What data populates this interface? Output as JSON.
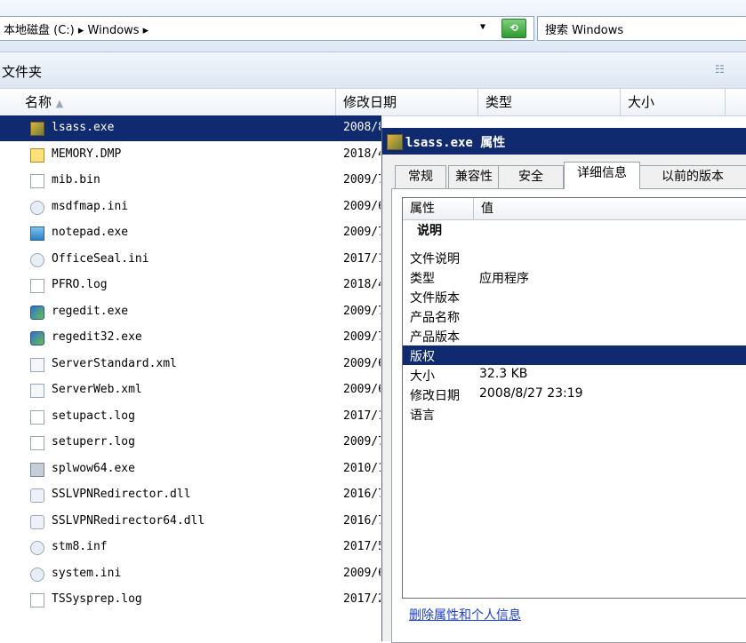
{
  "address": {
    "path": "本地磁盘 (C:) ▸ Windows ▸",
    "dropdown_arrow": "▼"
  },
  "search": {
    "placeholder": "搜索 Windows"
  },
  "folder": {
    "title": "文件夹"
  },
  "columns": {
    "name": "名称",
    "modified": "修改日期",
    "type": "类型",
    "size": "大小"
  },
  "files": [
    {
      "name": "lsass.exe",
      "date": "2008/8",
      "icon": "lsass-icon",
      "selected": true
    },
    {
      "name": "MEMORY.DMP",
      "date": "2018/4",
      "icon": "dump-file-icon"
    },
    {
      "name": "mib.bin",
      "date": "2009/7",
      "icon": "file-icon"
    },
    {
      "name": "msdfmap.ini",
      "date": "2009/6",
      "icon": "config-file-icon"
    },
    {
      "name": "notepad.exe",
      "date": "2009/7",
      "icon": "notepad-icon"
    },
    {
      "name": "OfficeSeal.ini",
      "date": "2017/1",
      "icon": "config-file-icon"
    },
    {
      "name": "PFRO.log",
      "date": "2018/4",
      "icon": "file-icon"
    },
    {
      "name": "regedit.exe",
      "date": "2009/7",
      "icon": "regedit-icon"
    },
    {
      "name": "regedit32.exe",
      "date": "2009/7",
      "icon": "regedit-icon"
    },
    {
      "name": "ServerStandard.xml",
      "date": "2009/6",
      "icon": "xml-file-icon"
    },
    {
      "name": "ServerWeb.xml",
      "date": "2009/6",
      "icon": "xml-file-icon"
    },
    {
      "name": "setupact.log",
      "date": "2017/1",
      "icon": "file-icon"
    },
    {
      "name": "setuperr.log",
      "date": "2009/7",
      "icon": "file-icon"
    },
    {
      "name": "splwow64.exe",
      "date": "2010/1",
      "icon": "exe-icon"
    },
    {
      "name": "SSLVPNRedirector.dll",
      "date": "2016/7",
      "icon": "dll-file-icon"
    },
    {
      "name": "SSLVPNRedirector64.dll",
      "date": "2016/7",
      "icon": "dll-file-icon"
    },
    {
      "name": "stm8.inf",
      "date": "2017/5",
      "icon": "config-file-icon"
    },
    {
      "name": "system.ini",
      "date": "2009/6",
      "icon": "config-file-icon"
    },
    {
      "name": "TSSysprep.log",
      "date": "2017/2",
      "icon": "file-icon"
    }
  ],
  "dialog": {
    "title_file": "lsass.exe",
    "title_suffix": "属性",
    "tabs": [
      "常规",
      "兼容性",
      "安全",
      "详细信息",
      "以前的版本"
    ],
    "active_tab": "详细信息",
    "list_headers": {
      "property": "属性",
      "value": "值"
    },
    "section": "说明",
    "properties": [
      {
        "key": "文件说明",
        "value": ""
      },
      {
        "key": "类型",
        "value": "应用程序"
      },
      {
        "key": "文件版本",
        "value": ""
      },
      {
        "key": "产品名称",
        "value": ""
      },
      {
        "key": "产品版本",
        "value": ""
      },
      {
        "key": "版权",
        "value": "",
        "selected": true
      },
      {
        "key": "大小",
        "value": "32.3 KB"
      },
      {
        "key": "修改日期",
        "value": "2008/8/27 23:19"
      },
      {
        "key": "语言",
        "value": ""
      }
    ],
    "remove_link": "删除属性和个人信息"
  },
  "colors": {
    "selection": "#0f2a6e",
    "link": "#1a3ec8"
  }
}
